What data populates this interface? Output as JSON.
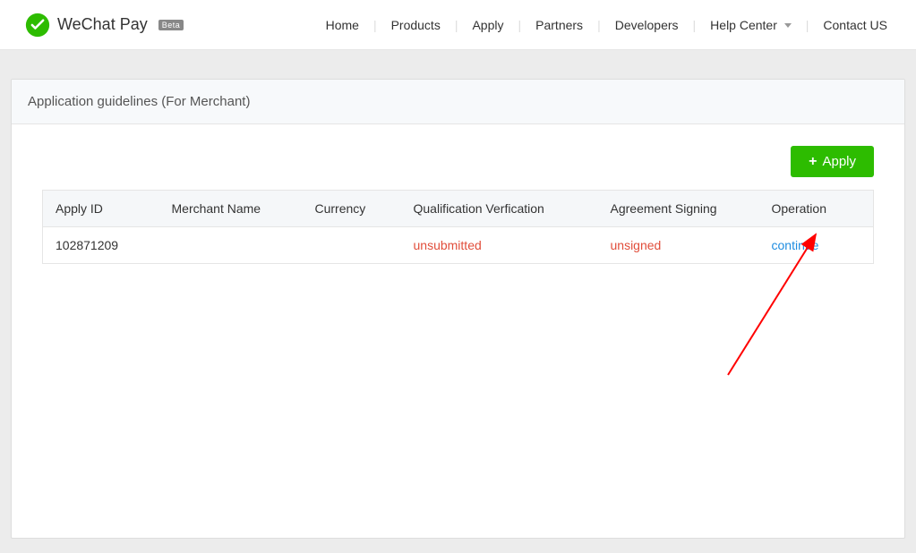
{
  "header": {
    "brand_name": "WeChat Pay",
    "badge": "Beta",
    "nav": {
      "home": "Home",
      "products": "Products",
      "apply": "Apply",
      "partners": "Partners",
      "developers": "Developers",
      "help_center": "Help Center",
      "contact_us": "Contact US"
    }
  },
  "panel": {
    "title": "Application guidelines (For Merchant)",
    "apply_button": "Apply"
  },
  "table": {
    "headers": {
      "apply_id": "Apply ID",
      "merchant_name": "Merchant Name",
      "currency": "Currency",
      "qualification": "Qualification Verfication",
      "agreement": "Agreement Signing",
      "operation": "Operation"
    },
    "rows": [
      {
        "apply_id": "102871209",
        "merchant_name": "",
        "currency": "",
        "qualification": "unsubmitted",
        "agreement": "unsigned",
        "operation": "continue"
      }
    ]
  }
}
